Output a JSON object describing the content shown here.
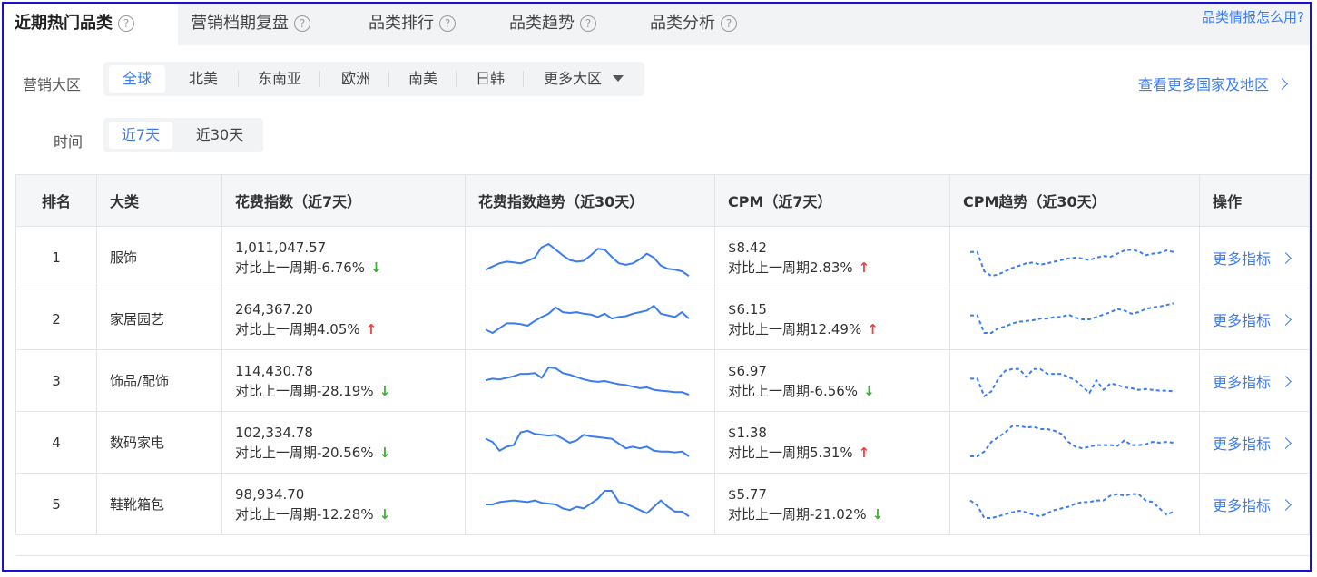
{
  "tabs": [
    {
      "label": "近期热门品类",
      "active": true
    },
    {
      "label": "营销档期复盘"
    },
    {
      "label": "品类排行"
    },
    {
      "label": "品类趋势"
    },
    {
      "label": "品类分析"
    }
  ],
  "help_link": "品类情报怎么用?",
  "region": {
    "label": "营销大区",
    "options": [
      "全球",
      "北美",
      "东南亚",
      "欧洲",
      "南美",
      "日韩",
      "更多大区"
    ],
    "selected": "全球"
  },
  "time": {
    "label": "时间",
    "options": [
      "近7天",
      "近30天"
    ],
    "selected": "近7天"
  },
  "more_regions_link": "查看更多国家及地区",
  "table": {
    "headers": [
      "排名",
      "大类",
      "花费指数（近7天）",
      "花费指数趋势（近30天）",
      "CPM（近7天）",
      "CPM趋势（近30天）",
      "操作"
    ],
    "rows": [
      {
        "rank": "1",
        "category": "服饰",
        "spend": "1,011,047.57",
        "spend_change": "对比上一周期-6.76%",
        "spend_dir": "down",
        "cpm": "$8.42",
        "cpm_change": "对比上一周期2.83%",
        "cpm_dir": "up",
        "action": "更多指标",
        "spend_trend": [
          40,
          44,
          48,
          50,
          49,
          48,
          51,
          55,
          68,
          72,
          65,
          58,
          52,
          50,
          51,
          58,
          66,
          65,
          56,
          48,
          46,
          48,
          53,
          60,
          55,
          45,
          41,
          40,
          38,
          32
        ],
        "cpm_trend": [
          62,
          62,
          38,
          32,
          34,
          38,
          42,
          45,
          48,
          49,
          46,
          48,
          50,
          52,
          54,
          55,
          54,
          52,
          55,
          57,
          56,
          60,
          64,
          65,
          63,
          58,
          60,
          61,
          64,
          62
        ]
      },
      {
        "rank": "2",
        "category": "家居园艺",
        "spend": "264,367.20",
        "spend_change": "对比上一周期4.05%",
        "spend_dir": "up",
        "cpm": "$6.15",
        "cpm_change": "对比上一周期12.49%",
        "cpm_dir": "up",
        "action": "更多指标",
        "spend_trend": [
          42,
          38,
          44,
          50,
          50,
          49,
          47,
          53,
          58,
          62,
          70,
          64,
          63,
          64,
          62,
          61,
          58,
          62,
          56,
          58,
          59,
          62,
          64,
          66,
          72,
          62,
          60,
          58,
          64,
          56
        ],
        "cpm_trend": [
          60,
          60,
          38,
          38,
          44,
          46,
          50,
          52,
          53,
          54,
          56,
          56,
          58,
          58,
          61,
          57,
          55,
          55,
          58,
          61,
          64,
          68,
          66,
          62,
          64,
          68,
          70,
          71,
          73,
          75
        ]
      },
      {
        "rank": "3",
        "category": "饰品/配饰",
        "spend": "114,430.78",
        "spend_change": "对比上一周期-28.19%",
        "spend_dir": "down",
        "cpm": "$6.97",
        "cpm_change": "对比上一周期-6.56%",
        "cpm_dir": "down",
        "action": "更多指标",
        "spend_trend": [
          56,
          58,
          57,
          59,
          61,
          64,
          64,
          65,
          59,
          72,
          71,
          65,
          63,
          60,
          57,
          55,
          54,
          55,
          53,
          51,
          50,
          48,
          46,
          47,
          44,
          43,
          42,
          41,
          41,
          38
        ],
        "cpm_trend": [
          58,
          58,
          36,
          42,
          58,
          68,
          70,
          70,
          60,
          70,
          70,
          64,
          64,
          64,
          60,
          56,
          48,
          40,
          56,
          44,
          52,
          50,
          47,
          46,
          44,
          45,
          44,
          43,
          43,
          42
        ]
      },
      {
        "rank": "4",
        "category": "数码家电",
        "spend": "102,334.78",
        "spend_change": "对比上一周期-20.56%",
        "spend_dir": "down",
        "cpm": "$1.38",
        "cpm_change": "对比上一周期5.31%",
        "cpm_dir": "up",
        "action": "更多指标",
        "spend_trend": [
          60,
          56,
          45,
          50,
          52,
          68,
          70,
          66,
          65,
          64,
          65,
          60,
          55,
          58,
          65,
          63,
          62,
          61,
          60,
          54,
          48,
          50,
          48,
          50,
          45,
          44,
          44,
          43,
          44,
          38
        ],
        "cpm_trend": [
          38,
          38,
          44,
          56,
          62,
          68,
          76,
          76,
          74,
          75,
          72,
          72,
          70,
          66,
          56,
          50,
          48,
          50,
          52,
          52,
          52,
          51,
          58,
          52,
          52,
          53,
          56,
          55,
          56,
          55
        ]
      },
      {
        "rank": "5",
        "category": "鞋靴箱包",
        "spend": "98,934.70",
        "spend_change": "对比上一周期-12.28%",
        "spend_dir": "down",
        "cpm": "$5.77",
        "cpm_change": "对比上一周期-21.02%",
        "cpm_dir": "down",
        "action": "更多指标",
        "spend_trend": [
          55,
          55,
          58,
          59,
          60,
          59,
          58,
          60,
          57,
          56,
          55,
          50,
          48,
          52,
          50,
          56,
          62,
          72,
          72,
          58,
          56,
          52,
          48,
          44,
          52,
          60,
          52,
          46,
          46,
          40
        ],
        "cpm_trend": [
          60,
          54,
          38,
          38,
          40,
          43,
          45,
          47,
          45,
          42,
          40,
          44,
          48,
          50,
          52,
          56,
          58,
          58,
          60,
          60,
          66,
          68,
          66,
          68,
          68,
          60,
          58,
          50,
          42,
          46
        ]
      }
    ]
  },
  "colors": {
    "accent": "#3b7cf0",
    "up": "#f04040",
    "down": "#33b52c",
    "frame": "#1a10d8"
  }
}
